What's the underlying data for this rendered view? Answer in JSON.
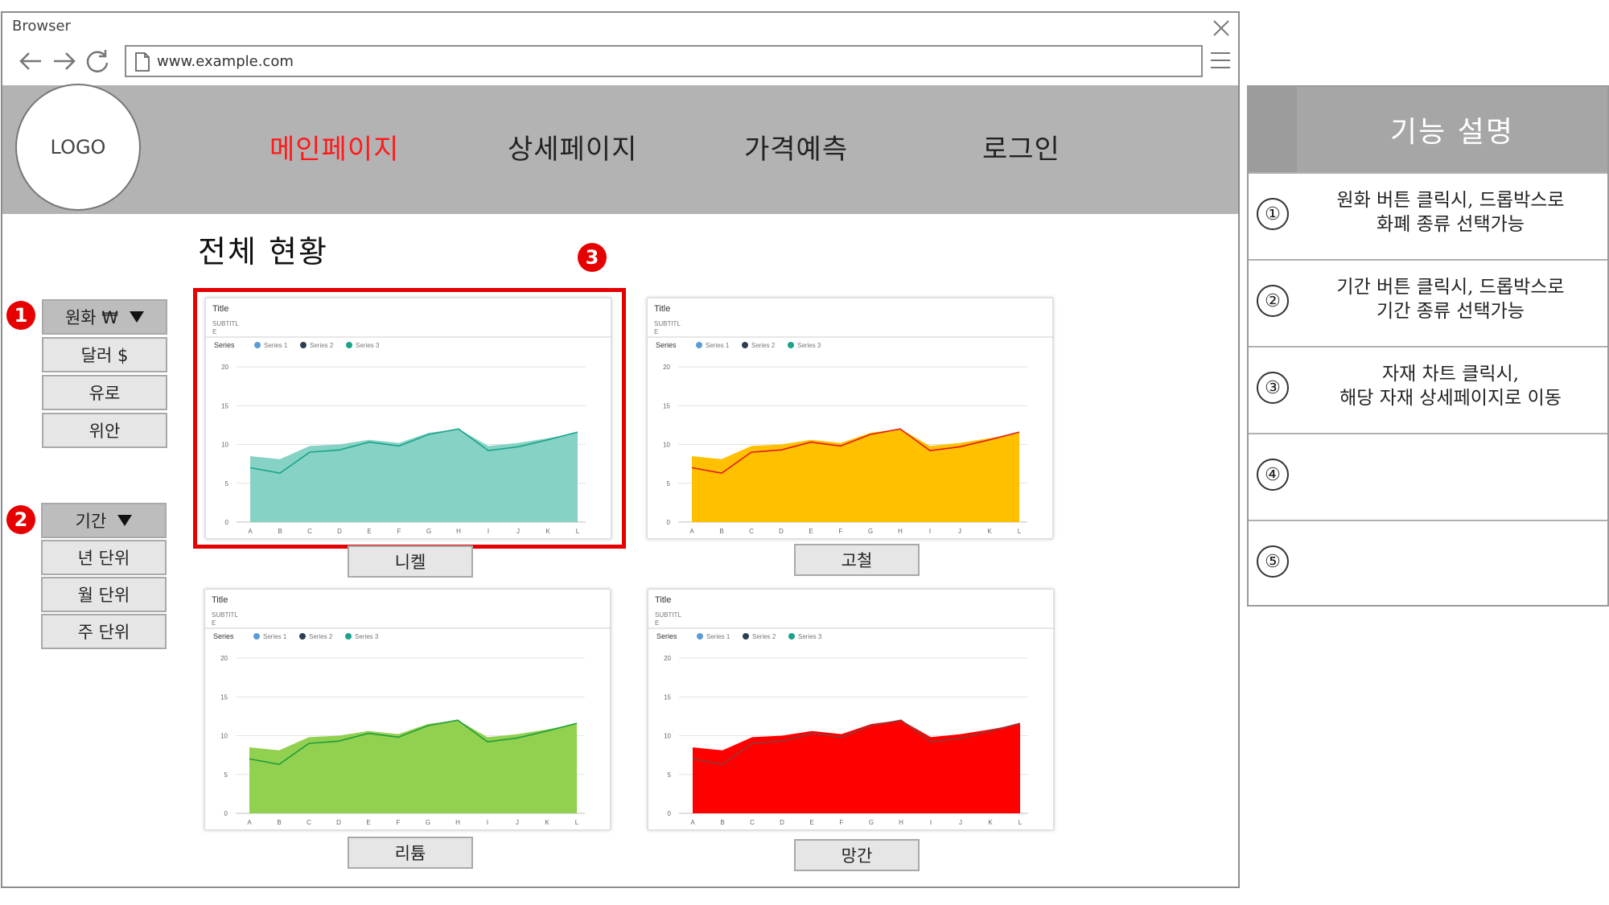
{
  "browser": {
    "title": "Browser",
    "url": "www.example.com"
  },
  "header": {
    "logo": "LOGO",
    "nav": [
      "메인페이지",
      "상세페이지",
      "가격예측",
      "로그인"
    ]
  },
  "main": {
    "title": "전체 현황",
    "marker1": "1",
    "marker2": "2",
    "marker3": "3"
  },
  "currency_menu": {
    "selected": "원화 ₩",
    "options": [
      "달러 $",
      "유로",
      "위안"
    ]
  },
  "period_menu": {
    "selected": "기간",
    "options": [
      "년 단위",
      "월 단위",
      "주 단위"
    ]
  },
  "chart_labels": [
    "니켈",
    "고철",
    "리튬",
    "망간"
  ],
  "chart_data": [
    {
      "type": "area",
      "title": "Title",
      "subtitle": "SUBTITLE",
      "legend_title": "Series",
      "categories": [
        "A",
        "B",
        "C",
        "D",
        "E",
        "F",
        "G",
        "H",
        "I",
        "J",
        "K",
        "L"
      ],
      "ylim": [
        0,
        20
      ],
      "yticks": [
        0,
        5,
        10,
        15,
        20
      ],
      "fill_color": "#86d3c5",
      "line_color": "#1aa38a",
      "series": [
        {
          "name": "Series 1",
          "color": "#5b9bd5",
          "values": [
            8.5,
            8.1,
            9.8,
            10.0,
            10.6,
            10.2,
            11.5,
            12.0,
            9.8,
            10.2,
            10.8,
            11.5
          ]
        },
        {
          "name": "Series 2",
          "color": "#2d3e50",
          "values": [
            7.0,
            6.3,
            9.0,
            9.3,
            10.3,
            9.8,
            11.3,
            12.0,
            9.2,
            9.7,
            10.6,
            11.6
          ]
        },
        {
          "name": "Series 3",
          "color": "#1aa38a",
          "values": [
            7.0,
            6.3,
            9.0,
            9.3,
            10.3,
            9.8,
            11.3,
            12.0,
            9.2,
            9.7,
            10.6,
            11.6
          ]
        }
      ]
    },
    {
      "type": "area",
      "title": "Title",
      "subtitle": "SUBTITLE",
      "legend_title": "Series",
      "categories": [
        "A",
        "B",
        "C",
        "D",
        "E",
        "F",
        "G",
        "H",
        "I",
        "J",
        "K",
        "L"
      ],
      "ylim": [
        0,
        20
      ],
      "yticks": [
        0,
        5,
        10,
        15,
        20
      ],
      "fill_color": "#ffc000",
      "line_color": "#e0191e",
      "series": [
        {
          "name": "Series 1",
          "color": "#5b9bd5",
          "values": [
            8.5,
            8.1,
            9.8,
            10.0,
            10.6,
            10.2,
            11.5,
            12.0,
            9.8,
            10.2,
            10.8,
            11.5
          ]
        },
        {
          "name": "Series 2",
          "color": "#2d3e50",
          "values": [
            7.0,
            6.3,
            9.0,
            9.3,
            10.3,
            9.8,
            11.3,
            12.0,
            9.2,
            9.7,
            10.6,
            11.6
          ]
        },
        {
          "name": "Series 3",
          "color": "#1aa38a",
          "values": [
            7.0,
            6.3,
            9.0,
            9.3,
            10.3,
            9.8,
            11.3,
            12.0,
            9.2,
            9.7,
            10.6,
            11.6
          ]
        }
      ]
    },
    {
      "type": "area",
      "title": "Title",
      "subtitle": "SUBTITLE",
      "legend_title": "Series",
      "categories": [
        "A",
        "B",
        "C",
        "D",
        "E",
        "F",
        "G",
        "H",
        "I",
        "J",
        "K",
        "L"
      ],
      "ylim": [
        0,
        20
      ],
      "yticks": [
        0,
        5,
        10,
        15,
        20
      ],
      "fill_color": "#92d050",
      "line_color": "#1e9e3a",
      "series": [
        {
          "name": "Series 1",
          "color": "#5b9bd5",
          "values": [
            8.5,
            8.1,
            9.8,
            10.0,
            10.6,
            10.2,
            11.5,
            12.0,
            9.8,
            10.2,
            10.8,
            11.5
          ]
        },
        {
          "name": "Series 2",
          "color": "#2d3e50",
          "values": [
            7.0,
            6.3,
            9.0,
            9.3,
            10.3,
            9.8,
            11.3,
            12.0,
            9.2,
            9.7,
            10.6,
            11.6
          ]
        },
        {
          "name": "Series 3",
          "color": "#1aa38a",
          "values": [
            7.0,
            6.3,
            9.0,
            9.3,
            10.3,
            9.8,
            11.3,
            12.0,
            9.2,
            9.7,
            10.6,
            11.6
          ]
        }
      ]
    },
    {
      "type": "area",
      "title": "Title",
      "subtitle": "SUBTITLE",
      "legend_title": "Series",
      "categories": [
        "A",
        "B",
        "C",
        "D",
        "E",
        "F",
        "G",
        "H",
        "I",
        "J",
        "K",
        "L"
      ],
      "ylim": [
        0,
        20
      ],
      "yticks": [
        0,
        5,
        10,
        15,
        20
      ],
      "fill_color": "#ff0000",
      "line_color": "#8c3a3a",
      "series": [
        {
          "name": "Series 1",
          "color": "#5b9bd5",
          "values": [
            8.5,
            8.1,
            9.8,
            10.0,
            10.6,
            10.2,
            11.5,
            12.0,
            9.8,
            10.2,
            10.8,
            11.5
          ]
        },
        {
          "name": "Series 2",
          "color": "#2d3e50",
          "values": [
            7.0,
            6.3,
            9.0,
            9.3,
            10.3,
            9.8,
            11.3,
            12.0,
            9.2,
            9.7,
            10.6,
            11.6
          ]
        },
        {
          "name": "Series 3",
          "color": "#1aa38a",
          "values": [
            7.0,
            6.3,
            9.0,
            9.3,
            10.3,
            9.8,
            11.3,
            12.0,
            9.2,
            9.7,
            10.6,
            11.6
          ]
        }
      ]
    }
  ],
  "description": {
    "title": "기능 설명",
    "rows": [
      {
        "num": "①",
        "text": "원화 버튼 클릭시, 드롭박스로\n화폐 종류 선택가능"
      },
      {
        "num": "②",
        "text": "기간 버튼 클릭시, 드롭박스로\n기간 종류 선택가능"
      },
      {
        "num": "③",
        "text": "자재 차트 클릭시,\n해당 자재 상세페이지로 이동"
      },
      {
        "num": "④",
        "text": ""
      },
      {
        "num": "⑤",
        "text": ""
      }
    ]
  },
  "colors": {
    "accent": "#ff1a1a",
    "header_bg": "#b3b3b3",
    "marker": "#e60000"
  }
}
